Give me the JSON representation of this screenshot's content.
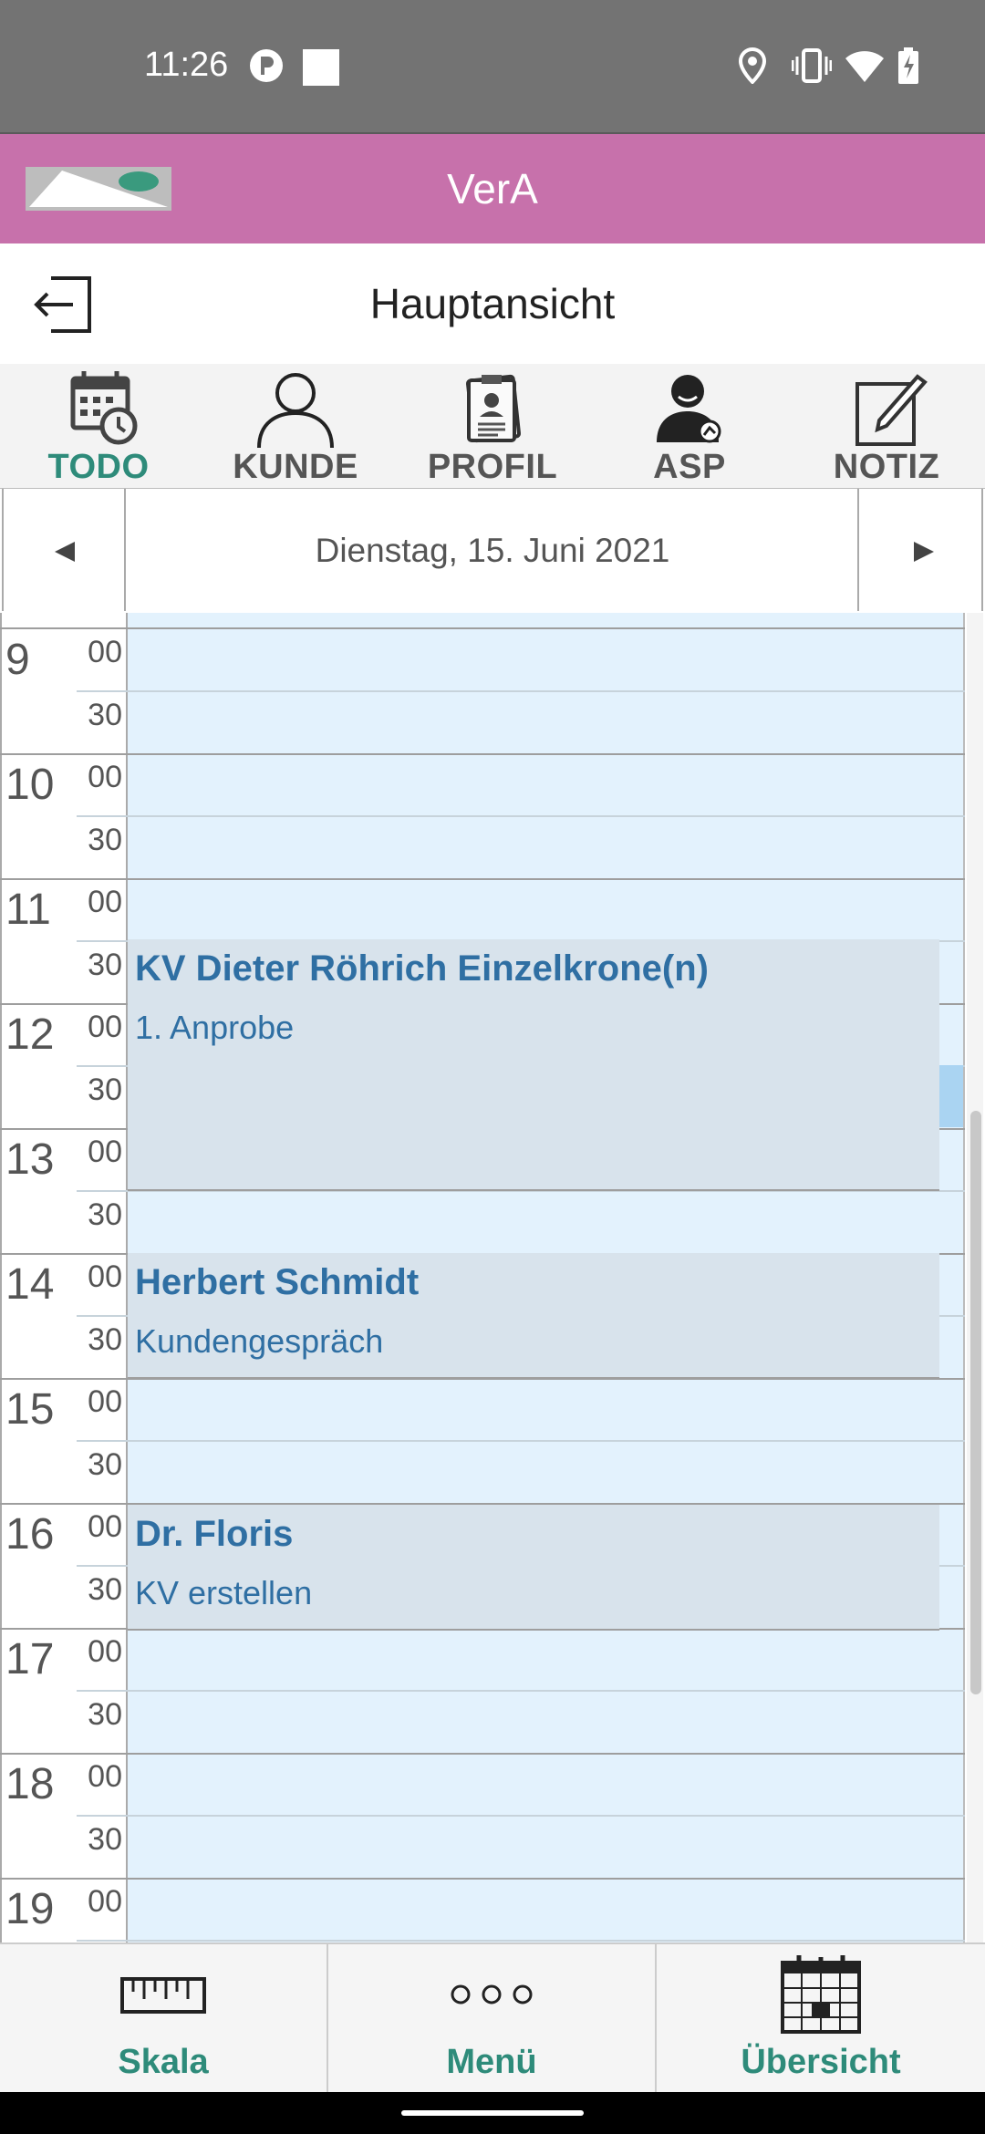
{
  "status_bar": {
    "time": "11:26"
  },
  "app_bar": {
    "title": "VerA"
  },
  "header": {
    "title": "Hauptansicht"
  },
  "toolbar": {
    "items": [
      {
        "label": "TODO",
        "icon": "calendar-clock-icon",
        "active": true
      },
      {
        "label": "KUNDE",
        "icon": "person-outline-icon",
        "active": false
      },
      {
        "label": "PROFIL",
        "icon": "profile-card-icon",
        "active": false
      },
      {
        "label": "ASP",
        "icon": "contact-person-icon",
        "active": false
      },
      {
        "label": "NOTIZ",
        "icon": "note-pencil-icon",
        "active": false
      }
    ]
  },
  "date_nav": {
    "date": "Dienstag, 15. Juni 2021"
  },
  "calendar": {
    "hours": [
      "9",
      "10",
      "11",
      "12",
      "13",
      "14",
      "15",
      "16",
      "17",
      "18",
      "19"
    ],
    "minutes": [
      "00",
      "30"
    ],
    "events": [
      {
        "title": "KV Dieter Röhrich Einzelkrone(n)",
        "subtitle": "1. Anprobe"
      },
      {
        "title": "Herbert Schmidt",
        "subtitle": "Kundengespräch"
      },
      {
        "title": "Dr. Floris",
        "subtitle": "KV erstellen"
      }
    ]
  },
  "bottom_nav": {
    "items": [
      {
        "label": "Skala",
        "icon": "ruler-icon"
      },
      {
        "label": "Menü",
        "icon": "dots-menu-icon"
      },
      {
        "label": "Übersicht",
        "icon": "calendar-grid-icon"
      }
    ]
  },
  "colors": {
    "app_bar": "#c771ab",
    "accent": "#2e8b7a",
    "event_text": "#2f6fa3",
    "slot_bg": "#e3f2fd"
  }
}
